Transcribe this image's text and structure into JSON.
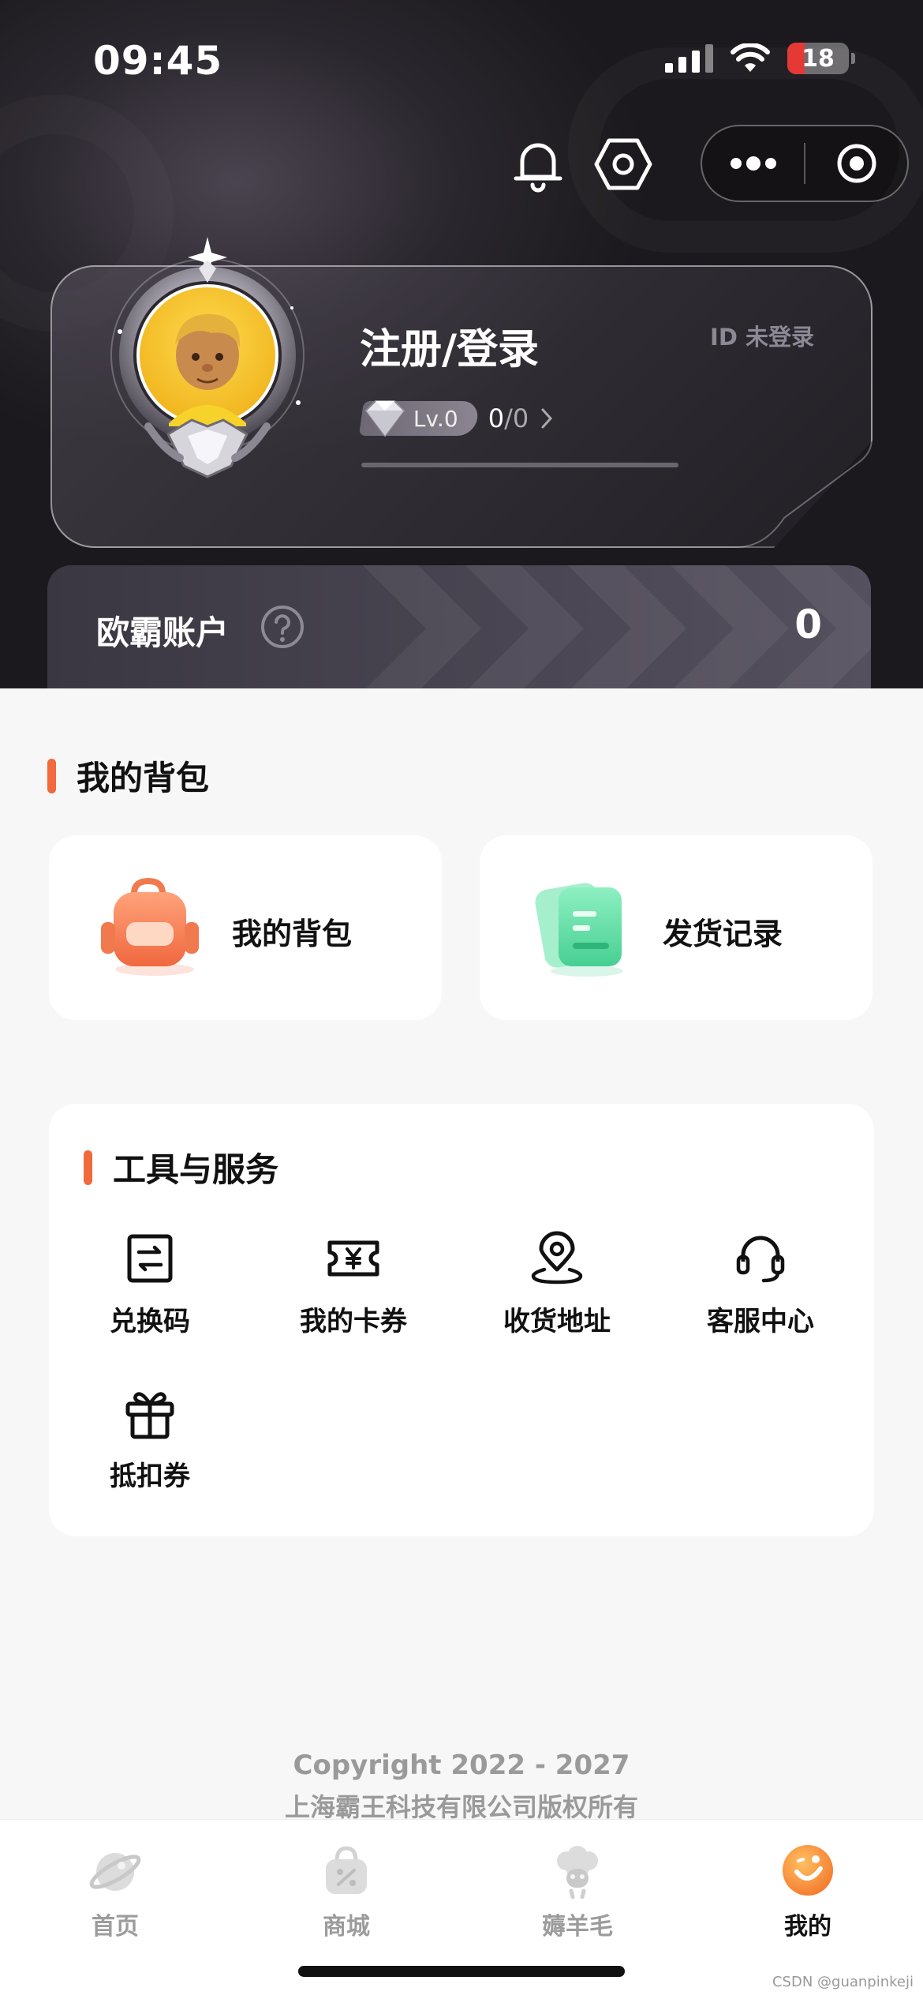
{
  "status_bar": {
    "time": "09:45",
    "battery": "18"
  },
  "header": {
    "bell_icon": "bell-icon",
    "settings_icon": "hexagon-settings-icon",
    "capsule_more_icon": "more-dots-icon",
    "capsule_close_icon": "record-circle-icon"
  },
  "profile": {
    "login_text": "注册/登录",
    "id_text": "ID 未登录",
    "level_label": "Lv.0",
    "progress_current": "0",
    "progress_separator": "/",
    "progress_max": "0",
    "progress_fraction": 0
  },
  "account": {
    "label": "欧霸账户",
    "value": "0"
  },
  "backpack_section": {
    "title": "我的背包",
    "cards": [
      {
        "label": "我的背包",
        "icon": "backpack-icon"
      },
      {
        "label": "发货记录",
        "icon": "document-icon"
      }
    ]
  },
  "tools_section": {
    "title": "工具与服务",
    "items": [
      {
        "label": "兑换码",
        "icon": "exchange-code-icon"
      },
      {
        "label": "我的卡券",
        "icon": "coupon-yen-icon"
      },
      {
        "label": "收货地址",
        "icon": "location-pin-icon"
      },
      {
        "label": "客服中心",
        "icon": "headset-icon"
      },
      {
        "label": "抵扣券",
        "icon": "gift-icon"
      }
    ]
  },
  "footer": {
    "copyright": "Copyright 2022 - 2027",
    "company": "上海霸王科技有限公司版权所有"
  },
  "tabbar": {
    "tabs": [
      {
        "label": "首页",
        "icon": "planet-icon",
        "active": false
      },
      {
        "label": "商城",
        "icon": "shopping-bag-icon",
        "active": false
      },
      {
        "label": "薅羊毛",
        "icon": "sheep-icon",
        "active": false
      },
      {
        "label": "我的",
        "icon": "profile-face-icon",
        "active": true
      }
    ]
  },
  "watermark": "CSDN @guanpinkeji",
  "colors": {
    "accent": "#f06a3c",
    "hero_bg": "#1b191d",
    "body_bg": "#f7f7f7",
    "backpack_orange": "#f28660",
    "record_green": "#5fd6a2"
  }
}
